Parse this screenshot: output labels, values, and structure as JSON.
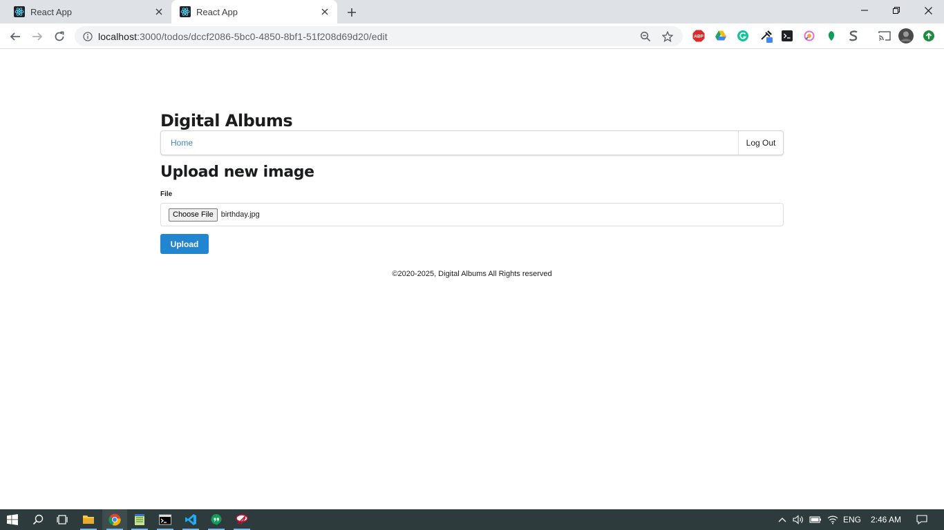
{
  "browser": {
    "tabs": [
      {
        "title": "React App",
        "active": false
      },
      {
        "title": "React App",
        "active": true
      }
    ],
    "address_host": "localhost",
    "address_rest": ":3000/todos/dccf2086-5bc0-4850-8bf1-51f208d69d20/edit",
    "extensions": [
      "adblock-plus-icon",
      "google-drive-icon",
      "grammarly-icon",
      "eyedropper-icon",
      "terminal-icon",
      "color-picker-icon",
      "leaf-icon",
      "stylus-icon"
    ]
  },
  "app": {
    "title": "Digital Albums",
    "menu": {
      "home": "Home",
      "logout": "Log Out"
    },
    "heading": "Upload new image",
    "file_label": "File",
    "choose_file": "Choose File",
    "file_name": "birthday.jpg",
    "upload_button": "Upload",
    "footer": "©2020-2025, Digital Albums All Rights reserved"
  },
  "taskbar": {
    "language": "ENG",
    "time": "2:46 AM"
  },
  "colors": {
    "primary_button": "#2185d0",
    "link": "#4183c4",
    "taskbar": "#2d3b3d"
  }
}
